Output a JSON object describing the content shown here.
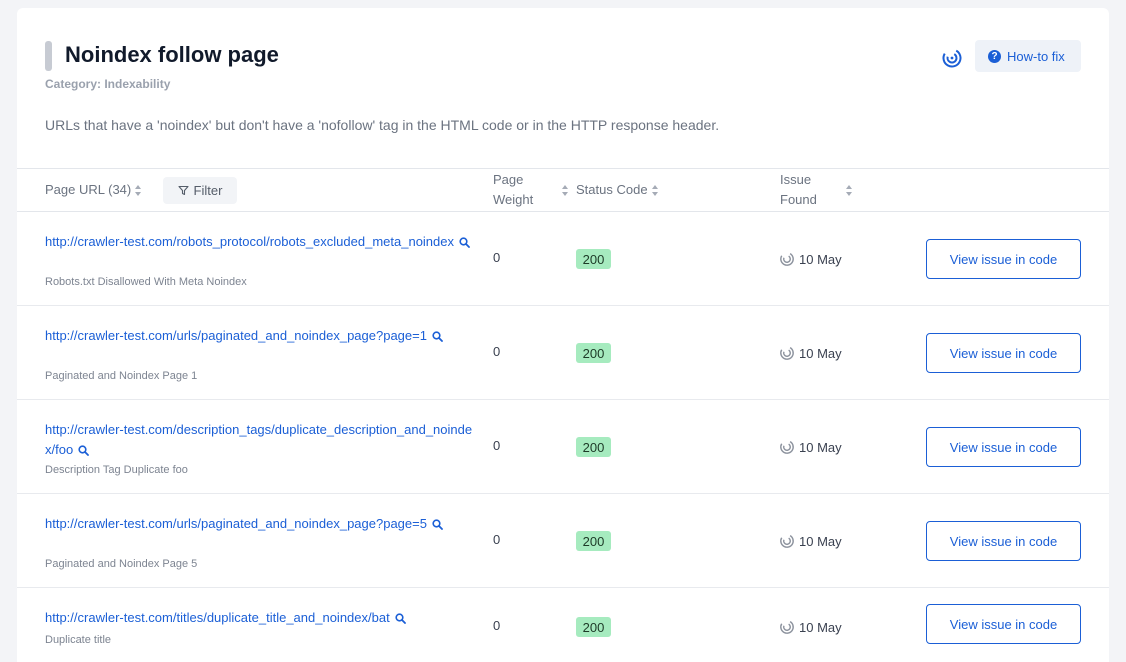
{
  "header": {
    "title": "Noindex follow page",
    "category": "Category: Indexability",
    "description": "URLs that have a 'noindex' but don't have a 'nofollow' tag in the HTML code or in the HTTP response header.",
    "howto_label": "How-to fix",
    "accent_color": "#1b5fd6"
  },
  "table": {
    "columns": {
      "url": "Page URL (34)",
      "filter": "Filter",
      "weight_line1": "Page",
      "weight_line2": "Weight",
      "status": "Status Code",
      "found_line1": "Issue",
      "found_line2": "Found"
    },
    "rows": [
      {
        "url": "http://crawler-test.com/robots_protocol/robots_excluded_meta_noindex",
        "subtitle": "Robots.txt Disallowed With Meta Noindex",
        "weight": "0",
        "status": "200",
        "found": "10 May",
        "action": "View issue in code"
      },
      {
        "url": "http://crawler-test.com/urls/paginated_and_noindex_page?page=1",
        "subtitle": "Paginated and Noindex Page 1",
        "weight": "0",
        "status": "200",
        "found": "10 May",
        "action": "View issue in code"
      },
      {
        "url": "http://crawler-test.com/description_tags/duplicate_description_and_noindex/foo",
        "subtitle": "Description Tag Duplicate foo",
        "weight": "0",
        "status": "200",
        "found": "10 May",
        "action": "View issue in code"
      },
      {
        "url": "http://crawler-test.com/urls/paginated_and_noindex_page?page=5",
        "subtitle": "Paginated and Noindex Page 5",
        "weight": "0",
        "status": "200",
        "found": "10 May",
        "action": "View issue in code"
      },
      {
        "url": "http://crawler-test.com/titles/duplicate_title_and_noindex/bat",
        "subtitle": "Duplicate title",
        "weight": "0",
        "status": "200",
        "found": "10 May",
        "action": "View issue in code"
      }
    ]
  }
}
